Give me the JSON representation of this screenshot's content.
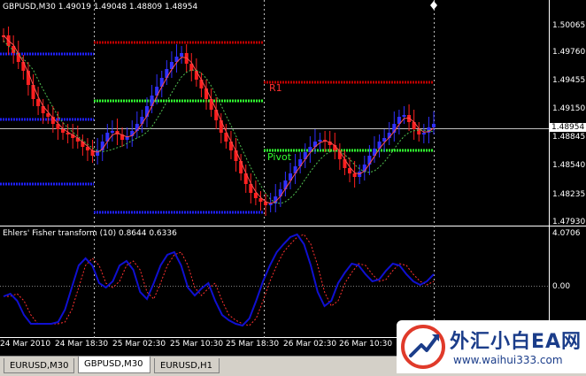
{
  "chart": {
    "header": "GBPUSD,M30  1.49019 1.49048 1.48809 1.48954",
    "price_ticks": [
      "1.50065",
      "1.49760",
      "1.49455",
      "1.49150",
      "1.48845",
      "1.48540",
      "1.48235",
      "1.47930"
    ],
    "current_price": "1.48954",
    "pivot_labels": {
      "r1": "R1",
      "pivot": "Pivot"
    },
    "indicator_header": "Ehlers' Fisher transform (10) 0.8644 0.6336",
    "indicator_ticks": [
      "4.0706",
      "0.00"
    ],
    "time_labels": [
      "24 Mar 2010",
      "24 Mar 18:30",
      "25 Mar 02:30",
      "25 Mar 10:30",
      "25 Mar 18:30",
      "26 Mar 02:30",
      "26 Mar 10:30"
    ],
    "colors": {
      "bull": "#3030ff",
      "bear": "#ff2020",
      "r1": "#c00000",
      "pivot": "#30ff30",
      "s1": "#2020ff",
      "fisher": "#1010d0",
      "trigger": "#ff3030"
    }
  },
  "tabs": [
    "EURUSD,M30",
    "GBPUSD,M30",
    "EURUSD,H1"
  ],
  "active_tab": "GBPUSD,M30",
  "watermark": {
    "title": "外汇小白EA网",
    "url": "www.waihui333.com"
  }
}
